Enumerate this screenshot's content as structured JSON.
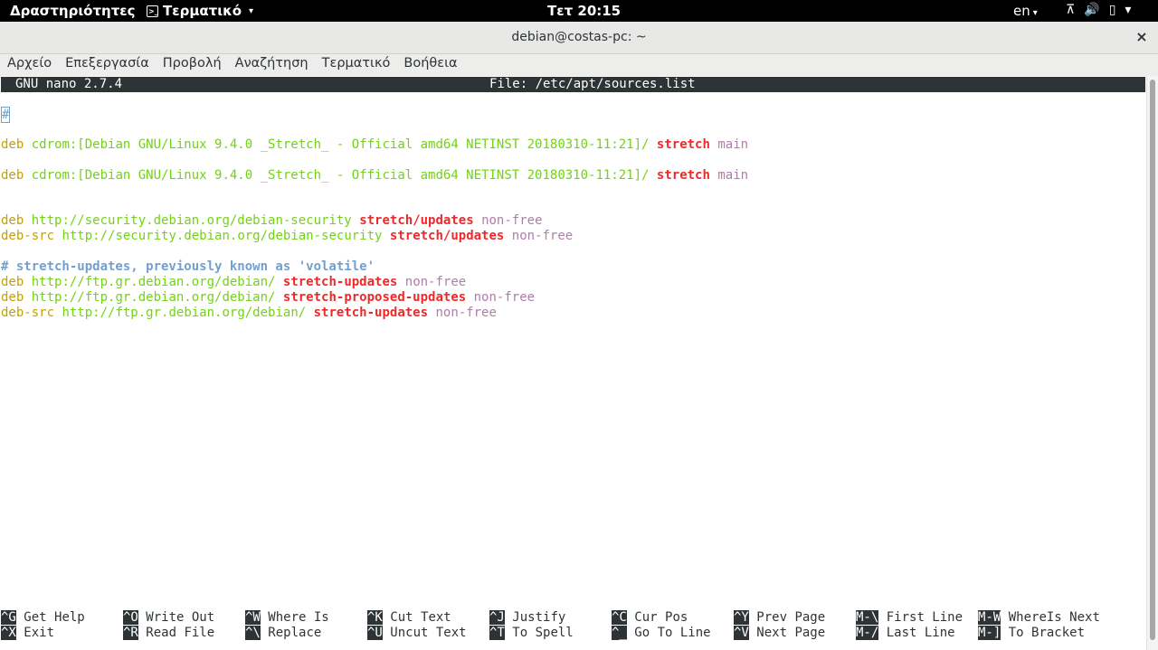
{
  "topbar": {
    "activities": "Δραστηριότητες",
    "app_menu": "Τερματικό",
    "clock": "Τετ 20:15",
    "lang": "en"
  },
  "window": {
    "title": "debian@costas-pc: ~",
    "close": "×"
  },
  "menubar": [
    "Αρχείο",
    "Επεξεργασία",
    "Προβολή",
    "Αναζήτηση",
    "Τερματικό",
    "Βοήθεια"
  ],
  "nano": {
    "version": "GNU nano 2.7.4",
    "file": "File: /etc/apt/sources.list"
  },
  "lines": [
    {
      "hash": "#"
    },
    {
      "type": "deb",
      "uri": "cdrom:[Debian GNU/Linux 9.4.0 _Stretch_ - Official amd64 NETINST 20180310-11:21]/",
      "suite": "stretch",
      "comp": "main"
    },
    {
      "type": "deb",
      "uri": "cdrom:[Debian GNU/Linux 9.4.0 _Stretch_ - Official amd64 NETINST 20180310-11:21]/",
      "suite": "stretch",
      "comp": "main"
    },
    {
      "type": "deb",
      "uri": "http://security.debian.org/debian-security",
      "suite": "stretch/updates",
      "comp": "non-free"
    },
    {
      "type": "deb-src",
      "uri": "http://security.debian.org/debian-security",
      "suite": "stretch/updates",
      "comp": "non-free"
    },
    {
      "comment": "# stretch-updates, previously known as 'volatile'"
    },
    {
      "type": "deb",
      "uri": "http://ftp.gr.debian.org/debian/",
      "suite": "stretch-updates",
      "comp": "non-free"
    },
    {
      "type": "deb",
      "uri": "http://ftp.gr.debian.org/debian/",
      "suite": "stretch-proposed-updates",
      "comp": "non-free"
    },
    {
      "type": "deb-src",
      "uri": "http://ftp.gr.debian.org/debian/",
      "suite": "stretch-updates",
      "comp": "non-free"
    }
  ],
  "shortcuts": [
    [
      {
        "key": "^G",
        "label": "Get Help"
      },
      {
        "key": "^X",
        "label": "Exit"
      }
    ],
    [
      {
        "key": "^O",
        "label": "Write Out"
      },
      {
        "key": "^R",
        "label": "Read File"
      }
    ],
    [
      {
        "key": "^W",
        "label": "Where Is"
      },
      {
        "key": "^\\",
        "label": "Replace"
      }
    ],
    [
      {
        "key": "^K",
        "label": "Cut Text"
      },
      {
        "key": "^U",
        "label": "Uncut Text"
      }
    ],
    [
      {
        "key": "^J",
        "label": "Justify"
      },
      {
        "key": "^T",
        "label": "To Spell"
      }
    ],
    [
      {
        "key": "^C",
        "label": "Cur Pos"
      },
      {
        "key": "^_",
        "label": "Go To Line"
      }
    ],
    [
      {
        "key": "^Y",
        "label": "Prev Page"
      },
      {
        "key": "^V",
        "label": "Next Page"
      }
    ],
    [
      {
        "key": "M-\\",
        "label": "First Line"
      },
      {
        "key": "M-/",
        "label": "Last Line"
      }
    ],
    [
      {
        "key": "M-W",
        "label": "WhereIs Next"
      },
      {
        "key": "M-]",
        "label": "To Bracket"
      }
    ]
  ]
}
